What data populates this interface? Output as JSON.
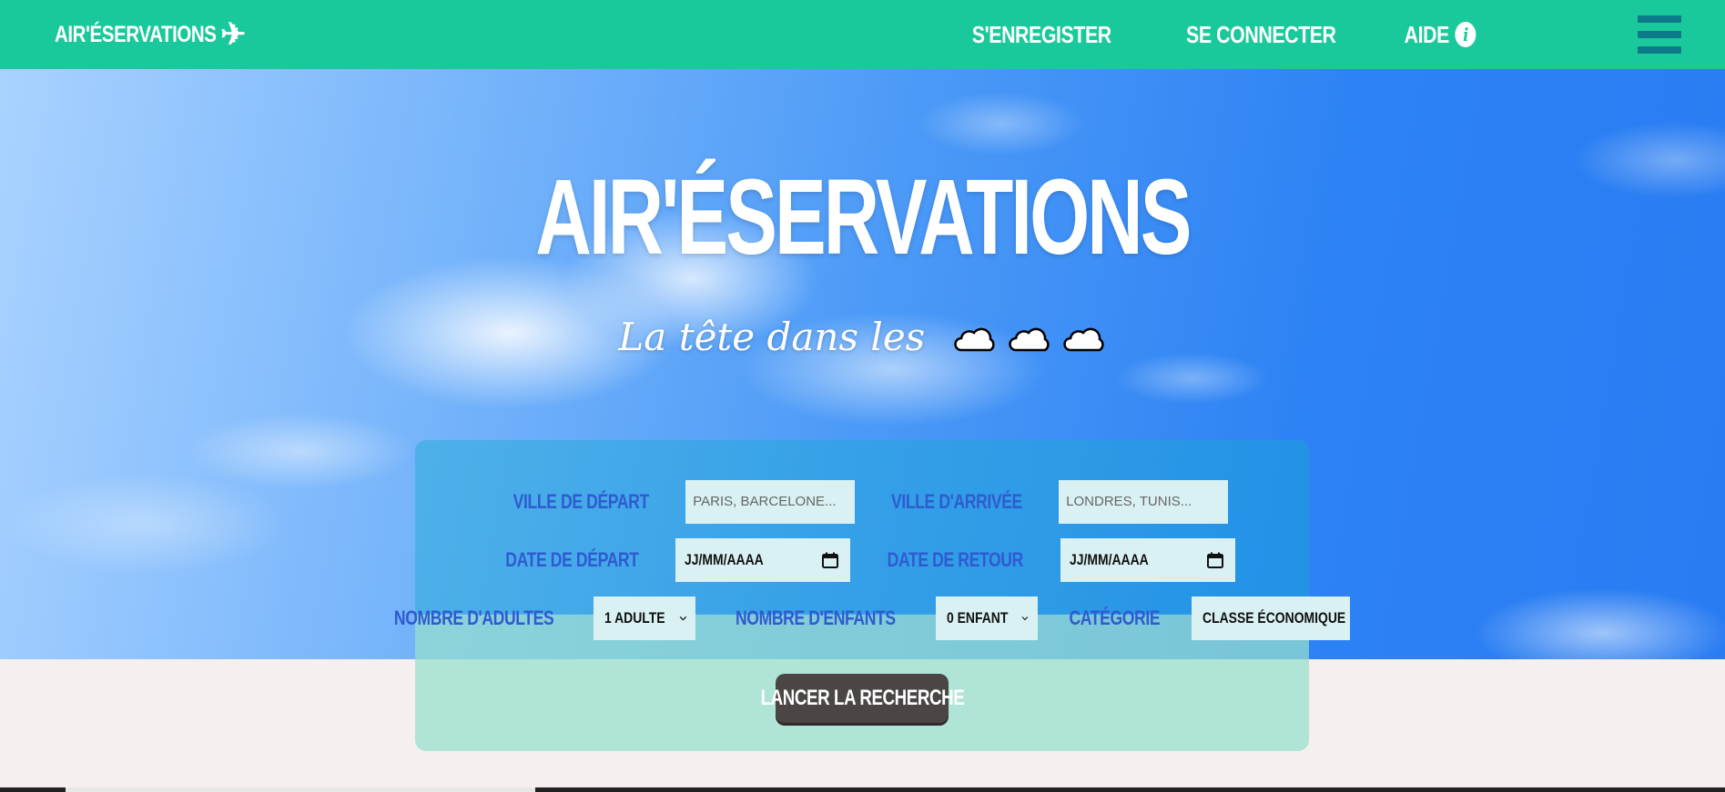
{
  "navbar": {
    "brand": "AIR'ÉSERVATIONS",
    "brand_icon": "airplane-icon",
    "links": {
      "register": "S'ENREGISTER",
      "login": "SE CONNECTER",
      "help": "AIDE"
    },
    "help_icon": "info-icon",
    "menu_icon": "hamburger-menu-icon"
  },
  "hero": {
    "title": "AIR'ÉSERVATIONS",
    "tagline": "La tête dans les",
    "tagline_icons": [
      "cloud-icon",
      "cloud-icon",
      "cloud-icon"
    ]
  },
  "search": {
    "departure_city": {
      "label": "VILLE DE DÉPART",
      "placeholder": "PARIS, BARCELONE...",
      "value": ""
    },
    "arrival_city": {
      "label": "VILLE D'ARRIVÉE",
      "placeholder": "LONDRES, TUNIS...",
      "value": ""
    },
    "departure_date": {
      "label": "DATE DE DÉPART",
      "value": "JJ/MM/AAAA"
    },
    "return_date": {
      "label": "DATE DE RETOUR",
      "value": "JJ/MM/AAAA"
    },
    "adults": {
      "label": "NOMBRE D'ADULTES",
      "selected": "1 ADULTE"
    },
    "children": {
      "label": "NOMBRE D'ENFANTS",
      "selected": "0 ENFANT"
    },
    "category": {
      "label": "CATÉGORIE",
      "selected": "CLASSE ÉCONOMIQUE"
    },
    "submit_label": "LANCER LA RECHERCHE"
  },
  "colors": {
    "navbar_bg": "#1ac99b",
    "label_blue": "#2f5bd0",
    "button_bg": "#4b4645",
    "page_bg": "#f5f0ef"
  }
}
